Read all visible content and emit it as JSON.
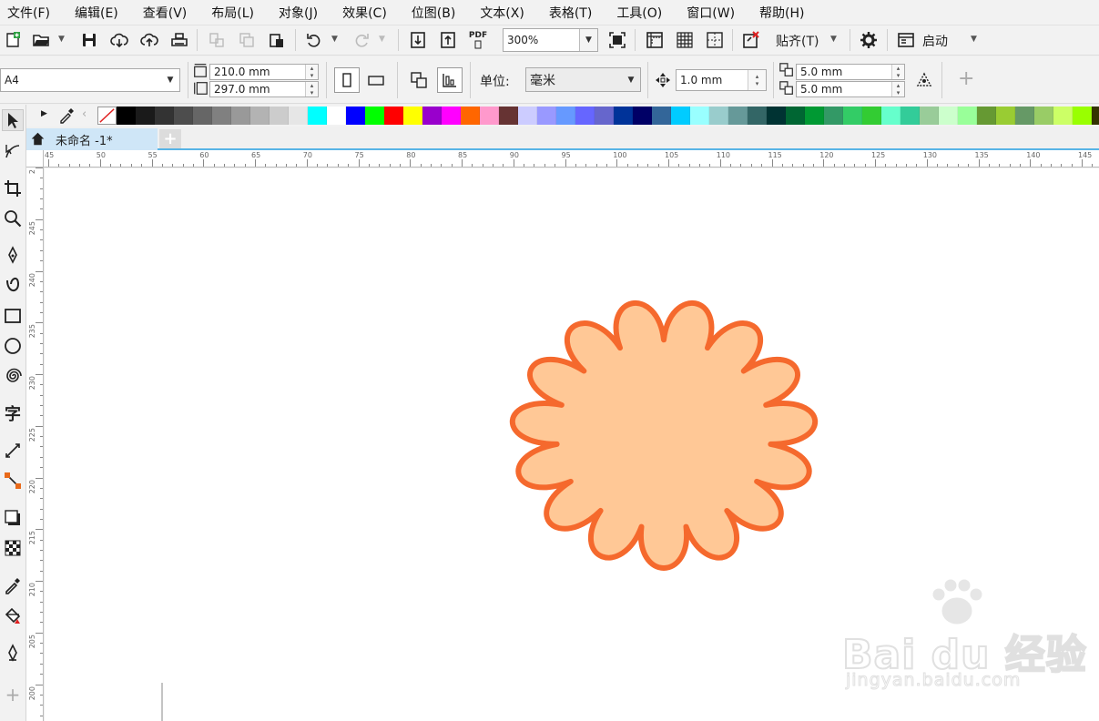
{
  "menu": [
    "文件(F)",
    "编辑(E)",
    "查看(V)",
    "布局(L)",
    "对象(J)",
    "效果(C)",
    "位图(B)",
    "文本(X)",
    "表格(T)",
    "工具(O)",
    "窗口(W)",
    "帮助(H)"
  ],
  "toolbar": {
    "zoom": "300%",
    "pdf_label": "PDF",
    "snap_label": "贴齐(T)",
    "launch_label": "启动"
  },
  "property_bar": {
    "page_size": "A4",
    "width": "210.0 mm",
    "height": "297.0 mm",
    "units_label": "单位:",
    "units_value": "毫米",
    "nudge": "1.0 mm",
    "dup_x": "5.0 mm",
    "dup_y": "5.0 mm"
  },
  "palette": {
    "colors": [
      "#000000",
      "#1a1a1a",
      "#333333",
      "#4d4d4d",
      "#666666",
      "#808080",
      "#999999",
      "#b3b3b3",
      "#cccccc",
      "#e6e6e6",
      "#00ffff",
      "#ffffff",
      "#0000ff",
      "#00ff00",
      "#ff0000",
      "#ffff00",
      "#9900cc",
      "#ff00ff",
      "#ff6600",
      "#ff99cc",
      "#663333",
      "#ccccff",
      "#9999ff",
      "#6699ff",
      "#6666ff",
      "#6666cc",
      "#003399",
      "#000066",
      "#336699",
      "#00ccff",
      "#99ffff",
      "#99cccc",
      "#669999",
      "#336666",
      "#003333",
      "#006633",
      "#009933",
      "#339966",
      "#33cc66",
      "#33cc33",
      "#66ffcc",
      "#33cc99",
      "#99cc99",
      "#ccffcc",
      "#99ff99",
      "#669933",
      "#99cc33",
      "#669966",
      "#99cc66",
      "#ccff66",
      "#99ff00",
      "#333300"
    ]
  },
  "document": {
    "tab_title": "未命名 -1*"
  },
  "rulers": {
    "h_labels": [
      "45",
      "50",
      "55",
      "60",
      "65",
      "70",
      "75",
      "80",
      "85",
      "90",
      "95",
      "100",
      "105",
      "110",
      "115",
      "120",
      "125",
      "130",
      "135",
      "140",
      "145"
    ],
    "v_labels": [
      "2",
      "245",
      "240",
      "235",
      "230",
      "225",
      "220",
      "215",
      "210",
      "205",
      "200",
      "195"
    ]
  },
  "shape": {
    "fill": "#ffc896",
    "stroke": "#f5692d",
    "petals": 15
  },
  "watermark": {
    "text": "Bai du 经验",
    "url": "jingyan.baidu.com"
  }
}
